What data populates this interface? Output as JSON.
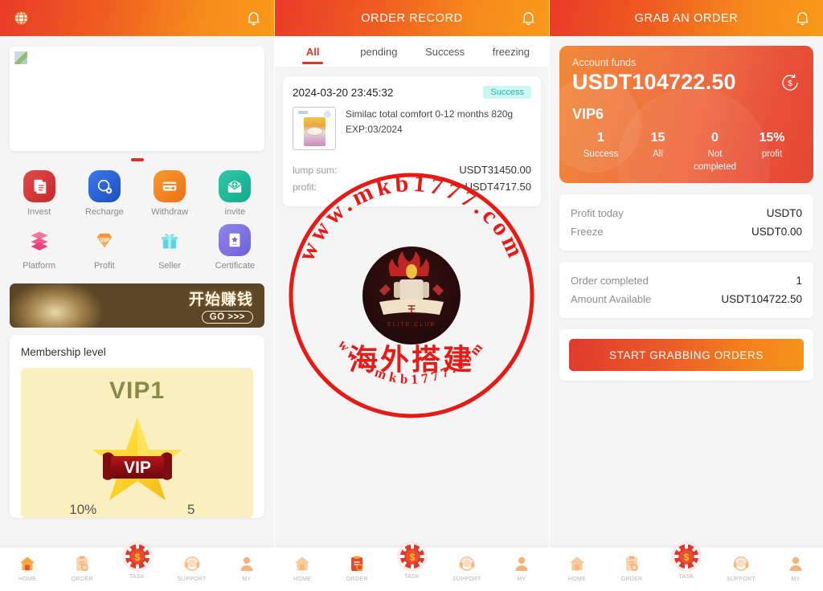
{
  "app": {
    "accent_red": "#e03529",
    "accent_orange": "#f7921b",
    "success_color": "#29b6aa"
  },
  "left_panel": {
    "header": {
      "title": "",
      "globe_icon": "globe-icon",
      "bell_icon": "bell-icon"
    },
    "carousel": {
      "dots_total": 1,
      "active_dot": 1
    },
    "quick_actions": [
      {
        "label": "Invest",
        "icon": "document-list-icon",
        "color": "#d93a3a"
      },
      {
        "label": "Recharge",
        "icon": "recharge-plus-icon",
        "color": "#2a65d8"
      },
      {
        "label": "Withdraw",
        "icon": "card-withdraw-icon",
        "color": "#f58220"
      },
      {
        "label": "invite",
        "icon": "invite-envelope-icon",
        "color": "#1fb89a"
      },
      {
        "label": "Platform",
        "icon": "layers-icon",
        "color": "#f05a8c"
      },
      {
        "label": "Profit",
        "icon": "vip-diamond-icon",
        "color": "#f68a3c"
      },
      {
        "label": "Seller",
        "icon": "gift-icon",
        "color": "#5fd4e0"
      },
      {
        "label": "Certificate",
        "icon": "certificate-icon",
        "color": "#7b6ae0"
      }
    ],
    "banner": {
      "title_cn": "开始赚钱",
      "cta": "GO >>>"
    },
    "membership": {
      "section_title": "Membership level",
      "level": "VIP1",
      "badge_text": "VIP",
      "stats": [
        {
          "value": "10%",
          "label": ""
        },
        {
          "value": "5",
          "label": ""
        }
      ]
    }
  },
  "mid_panel": {
    "header": {
      "title": "ORDER RECORD",
      "bell_icon": "bell-icon"
    },
    "tabs": [
      {
        "label": "All",
        "active": true
      },
      {
        "label": "pending",
        "active": false
      },
      {
        "label": "Success",
        "active": false
      },
      {
        "label": "freezing",
        "active": false
      }
    ],
    "orders": [
      {
        "datetime": "2024-03-20 23:45:32",
        "status": "Success",
        "product_name": "Similac total comfort 0-12 months 820g",
        "expiry": "EXP:03/2024",
        "rows": [
          {
            "key": "lump sum:",
            "value": "USDT31450.00"
          },
          {
            "key": "profit:",
            "value": "USDT4717.50"
          }
        ]
      }
    ]
  },
  "right_panel": {
    "header": {
      "title": "GRAB AN ORDER",
      "bell_icon": "bell-icon"
    },
    "funds": {
      "label": "Account funds",
      "amount": "USDT104722.50",
      "refresh_icon": "dollar-refresh-icon",
      "vip_level": "VIP6",
      "stats": [
        {
          "value": "1",
          "label": "Success"
        },
        {
          "value": "15",
          "label": "All"
        },
        {
          "value": "0",
          "label": "Not completed"
        },
        {
          "value": "15%",
          "label": "profit"
        }
      ]
    },
    "info_groups": [
      [
        {
          "key": "Profit today",
          "value": "USDT0"
        },
        {
          "key": "Freeze",
          "value": "USDT0.00"
        }
      ],
      [
        {
          "key": "Order completed",
          "value": "1"
        },
        {
          "key": "Amount Available",
          "value": "USDT104722.50"
        }
      ]
    ],
    "grab_button": "START GRABBING ORDERS"
  },
  "bottom_nav": {
    "items": [
      {
        "label": "HOME",
        "icon": "home-icon"
      },
      {
        "label": "ORDER",
        "icon": "clipboard-icon"
      },
      {
        "label": "TASK",
        "icon": "casino-chip-icon"
      },
      {
        "label": "SUPPORT",
        "icon": "headset-icon"
      },
      {
        "label": "MY",
        "icon": "user-icon"
      }
    ],
    "active_left": "HOME",
    "active_mid": "ORDER",
    "active_right": "HOME"
  },
  "watermark": {
    "top_text": "www.mkb1777.com",
    "bottom_text": "www.mkb1777.com",
    "center_text": "海外搭建",
    "color": "#e81a16"
  }
}
